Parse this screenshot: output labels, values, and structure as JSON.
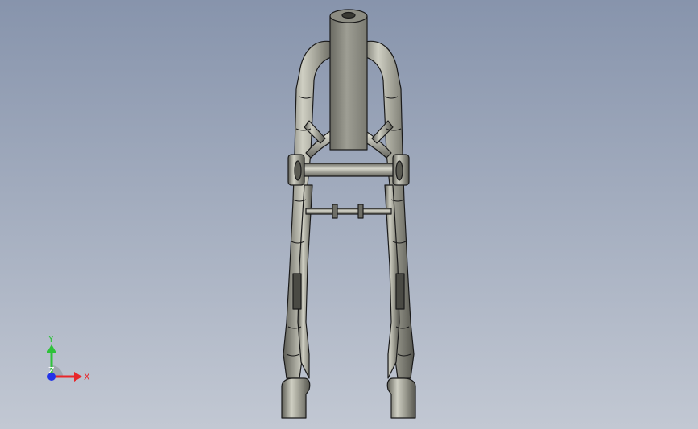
{
  "viewport": {
    "background_top": "#8794ac",
    "background_bottom": "#c2c8d3"
  },
  "model": {
    "body_color": "#84847a",
    "highlight_color": "#c4c4b8",
    "edge_color": "#1a1a1a"
  },
  "triad": {
    "x_label": "X",
    "y_label": "Y",
    "z_label": "Z",
    "x_color": "#e8262a",
    "y_color": "#2ec23a",
    "z_color": "#2233e8"
  }
}
